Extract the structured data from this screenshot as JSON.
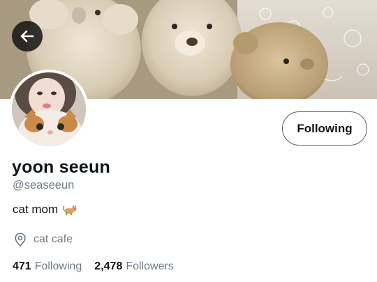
{
  "profile": {
    "display_name": "yoon seeun",
    "handle": "@seaseeun",
    "bio": "cat mom",
    "bio_emoji": "cat-emoji",
    "location": "cat cafe"
  },
  "actions": {
    "follow_label": "Following"
  },
  "stats": {
    "following_count": "471",
    "following_label": "Following",
    "followers_count": "2,478",
    "followers_label": "Followers"
  },
  "icons": {
    "back": "arrow-left-icon",
    "location": "location-pin-icon"
  },
  "colors": {
    "text_primary": "#0f1419",
    "text_secondary": "#6e7c88",
    "button_border": "#55606a"
  }
}
